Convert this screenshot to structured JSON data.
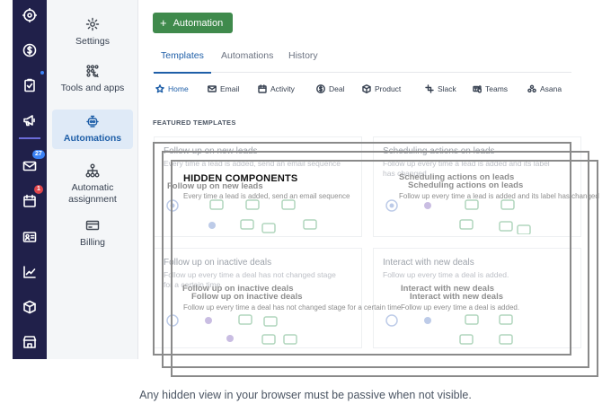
{
  "rail": {
    "badges": {
      "mail_count": "27",
      "calendar_count": "1"
    }
  },
  "subnav": {
    "items": [
      {
        "label": "Settings"
      },
      {
        "label": "Tools and apps"
      },
      {
        "label": "Automations"
      },
      {
        "label": "Automatic assignment"
      },
      {
        "label": "Billing"
      }
    ]
  },
  "main": {
    "add_button": "Automation",
    "tabs": [
      "Templates",
      "Automations",
      "History"
    ],
    "chips": [
      "Home",
      "Email",
      "Activity",
      "Deal",
      "Product",
      "Slack",
      "Teams",
      "Asana"
    ],
    "section_label": "FEATURED TEMPLATES",
    "cards": [
      {
        "title": "Follow up on new leads",
        "desc": "Every time a lead is added, send an email sequence"
      },
      {
        "title": "Scheduling actions on leads",
        "desc": "Follow up every time a lead is added and its label has changed"
      },
      {
        "title": "Follow up on inactive deals",
        "desc": "Follow up every time a deal has not changed stage for a certain time"
      },
      {
        "title": "Interact with new deals",
        "desc": "Follow up every time a deal is added."
      }
    ]
  },
  "overlay": {
    "label": "HIDDEN COMPONENTS",
    "ghost_titles": [
      "Follow up on new leads",
      "Scheduling actions on leads",
      "Follow up on inactive deals",
      "Interact with new deals"
    ],
    "ghost_descs": [
      "Every time a lead is added, send an email sequence",
      "Follow up every time a lead is added and its label has changed",
      "Follow up every time a deal has not changed stage for a certain time",
      "Follow up every time a deal is added."
    ]
  },
  "caption": "Any hidden view in your browser must be passive when not visible.",
  "colors": {
    "rail_bg": "#20204a",
    "accent_blue": "#1f5fa8",
    "add_green": "#3f8a4c",
    "badge_blue": "#3b82f6",
    "badge_red": "#e0454b"
  }
}
